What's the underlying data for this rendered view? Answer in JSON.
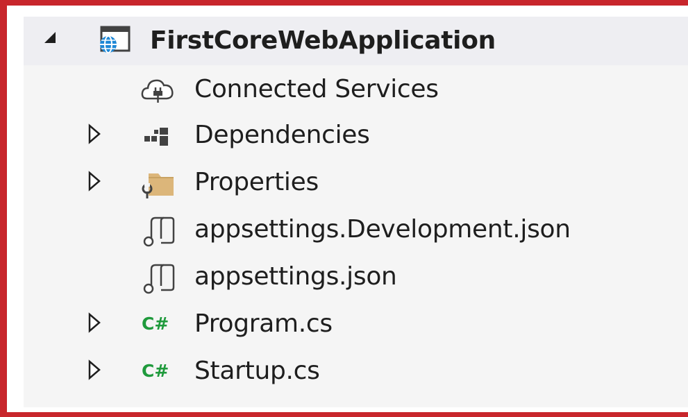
{
  "solution_explorer": {
    "project": {
      "label": "FirstCoreWebApplication",
      "icon": "web-project-icon",
      "expanded": true
    },
    "items": [
      {
        "label": "Connected Services",
        "icon": "cloud-plug-icon",
        "expandable": false
      },
      {
        "label": "Dependencies",
        "icon": "dependencies-icon",
        "expandable": true
      },
      {
        "label": "Properties",
        "icon": "properties-folder-icon",
        "expandable": true
      },
      {
        "label": "appsettings.Development.json",
        "icon": "json-file-icon",
        "expandable": false
      },
      {
        "label": "appsettings.json",
        "icon": "json-file-icon",
        "expandable": false
      },
      {
        "label": "Program.cs",
        "icon": "csharp-file-icon",
        "expandable": true,
        "icon_text": "C#"
      },
      {
        "label": "Startup.cs",
        "icon": "csharp-file-icon",
        "expandable": true,
        "icon_text": "C#"
      }
    ]
  },
  "colors": {
    "frame_border": "#c8262c",
    "csharp_icon": "#1f9a3c",
    "web_icon": "#1e88d6",
    "folder_icon": "#dcb67a"
  }
}
